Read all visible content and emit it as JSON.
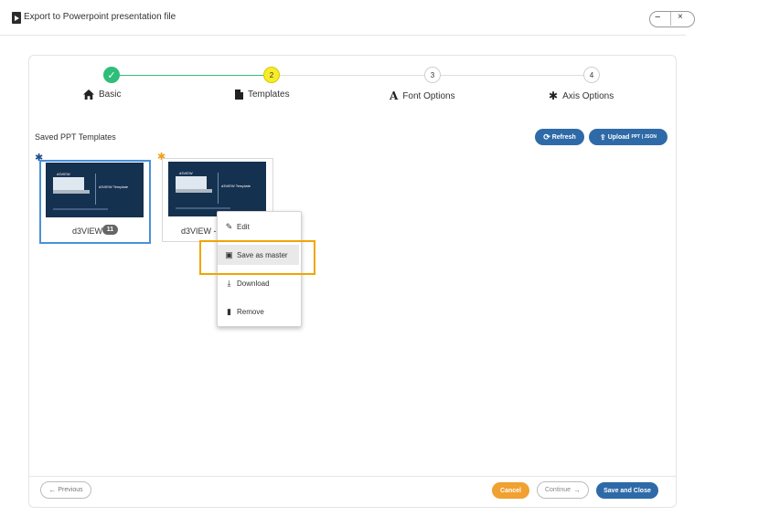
{
  "window": {
    "title": "Export to Powerpoint presentation file",
    "minimize_glyph": "−",
    "close_glyph": "×"
  },
  "wizard": {
    "steps": [
      {
        "number": "✓",
        "label": "Basic",
        "icon": "home-icon",
        "status": "complete"
      },
      {
        "number": "2",
        "label": "Templates",
        "icon": "file-icon",
        "status": "active"
      },
      {
        "number": "3",
        "label": "Font Options",
        "icon": "font-icon",
        "status": "pending"
      },
      {
        "number": "4",
        "label": "Axis Options",
        "icon": "gear-icon",
        "status": "pending"
      }
    ]
  },
  "templates": {
    "section_label": "Saved PPT Templates",
    "refresh_label": "Refresh",
    "upload_label": "Upload",
    "upload_sublabel": "PPT | JSON",
    "cards": [
      {
        "name": "d3VIEW",
        "badge": "11",
        "thumb_title": "d3VIEW Template",
        "thumb_sub": "d3VIEW",
        "selected": true,
        "star_color": "#1d4f91"
      },
      {
        "name": "d3VIEW -",
        "thumb_title": "d3VIEW Template",
        "thumb_sub": "d3VIEW",
        "selected": false,
        "star_color": "#f0a11a"
      }
    ]
  },
  "context_menu": {
    "items": [
      {
        "label": "Edit",
        "icon": "edit-icon"
      },
      {
        "label": "Save as master",
        "icon": "save-icon",
        "highlighted": true
      },
      {
        "label": "Download",
        "icon": "download-icon"
      },
      {
        "label": "Remove",
        "icon": "trash-icon"
      }
    ]
  },
  "footer": {
    "previous_label": "Previous",
    "cancel_label": "Cancel",
    "continue_label": "Continue",
    "save_close_label": "Save and Close"
  },
  "colors": {
    "accent_blue": "#2f6aa8",
    "step_complete": "#2fbd7a",
    "step_active": "#f6ec2a",
    "cancel_orange": "#f0a131",
    "highlight_box": "#f0a500"
  }
}
